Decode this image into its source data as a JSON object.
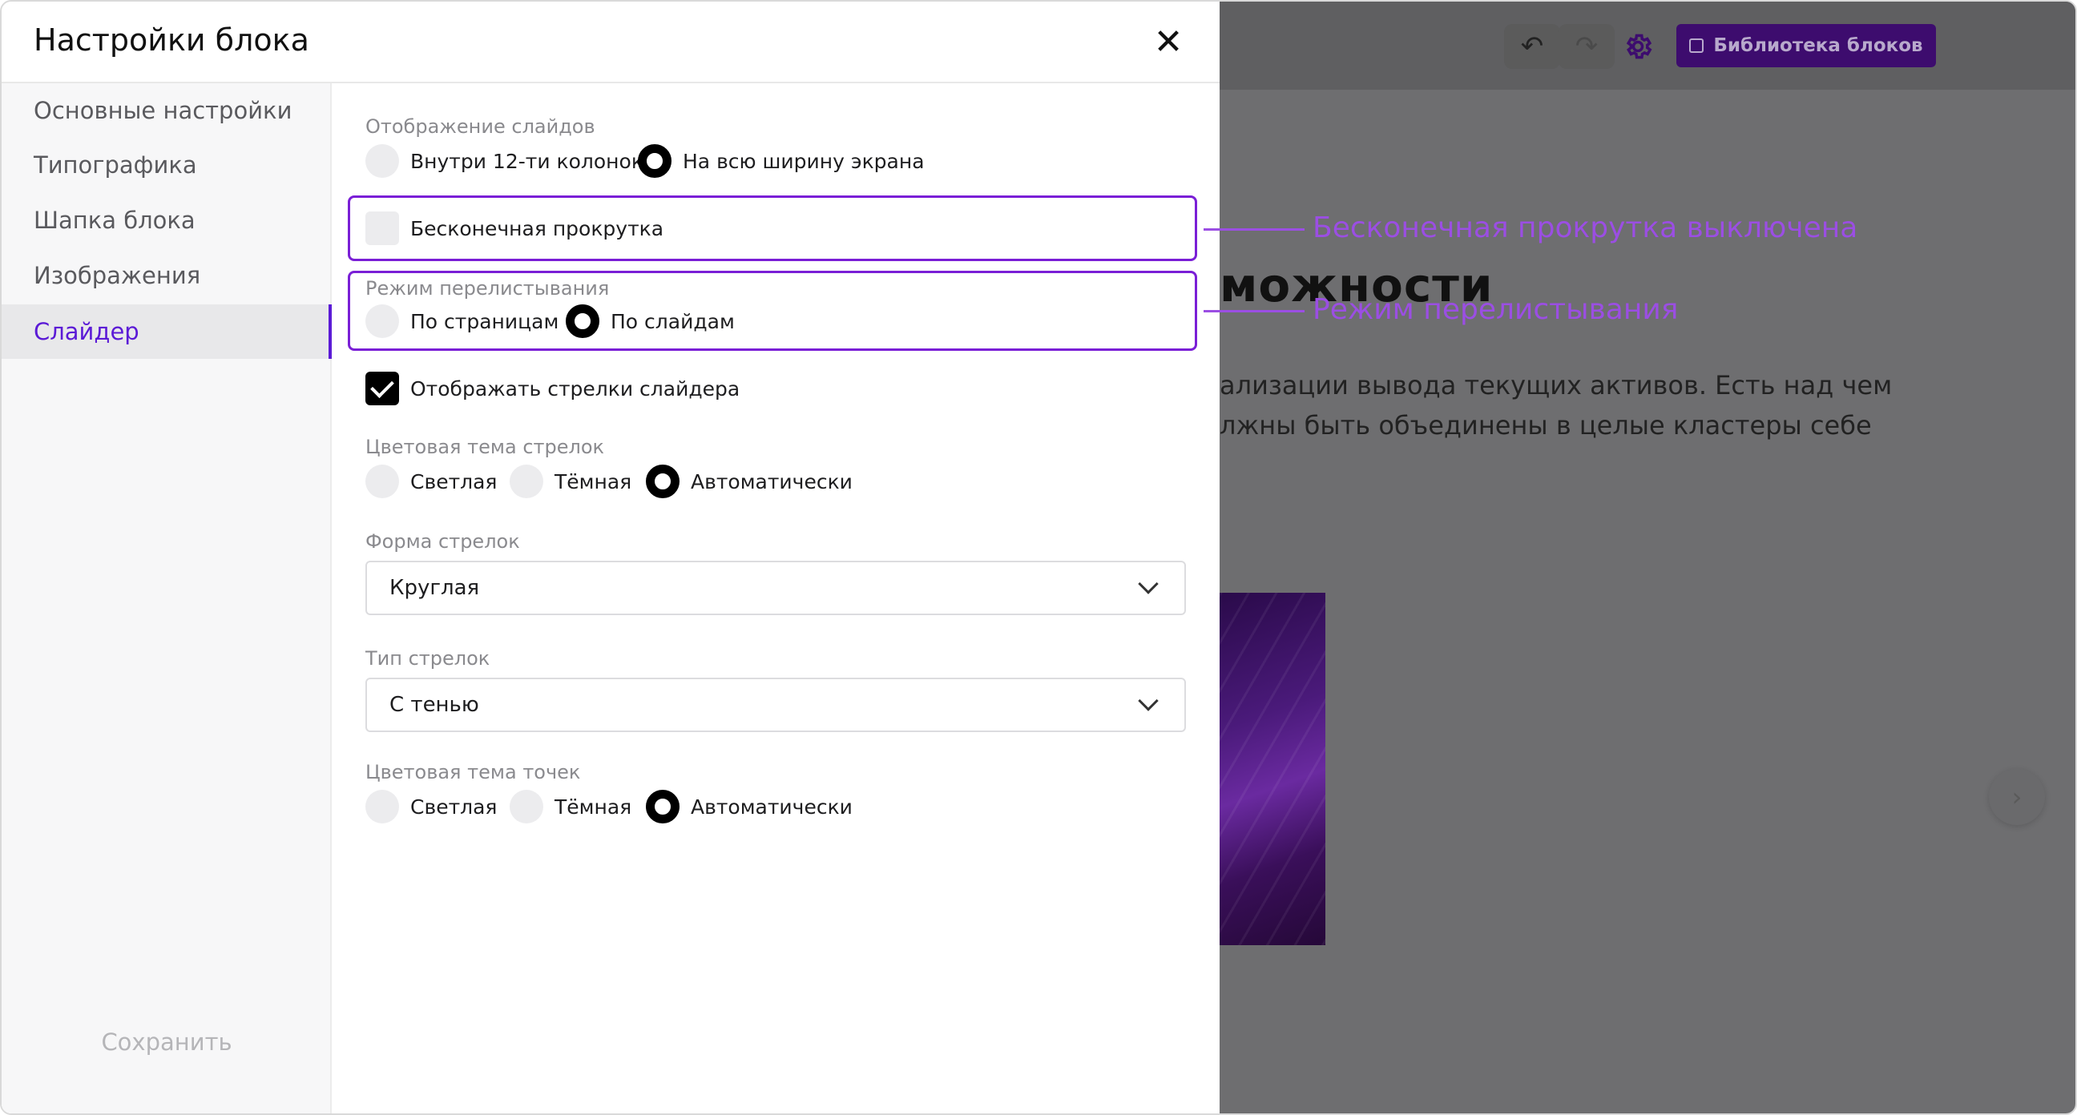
{
  "modal": {
    "title": "Настройки блока",
    "close_glyph": "✕"
  },
  "sidebar": {
    "items": [
      {
        "label": "Основные настройки",
        "active": false
      },
      {
        "label": "Типографика",
        "active": false
      },
      {
        "label": "Шапка блока",
        "active": false
      },
      {
        "label": "Изображения",
        "active": false
      },
      {
        "label": "Слайдер",
        "active": true
      }
    ],
    "save_label": "Сохранить"
  },
  "settings": {
    "slide_display": {
      "label": "Отображение слайдов",
      "options": [
        "Внутри 12-ти колонок",
        "На всю ширину экрана"
      ],
      "selected": "На всю ширину экрана"
    },
    "infinite_scroll": {
      "label": "Бесконечная прокрутка",
      "checked": false
    },
    "scroll_mode": {
      "label": "Режим перелистывания",
      "options": [
        "По страницам",
        "По слайдам"
      ],
      "selected": "По слайдам"
    },
    "show_arrows": {
      "label": "Отображать стрелки слайдера",
      "checked": true
    },
    "arrow_theme": {
      "label": "Цветовая тема стрелок",
      "options": [
        "Светлая",
        "Тёмная",
        "Автоматически"
      ],
      "selected": "Автоматически"
    },
    "arrow_shape": {
      "label": "Форма стрелок",
      "value": "Круглая"
    },
    "arrow_type": {
      "label": "Тип стрелок",
      "value": "С тенью"
    },
    "dot_theme": {
      "label": "Цветовая тема точек",
      "options": [
        "Светлая",
        "Тёмная",
        "Автоматически"
      ],
      "selected": "Автоматически"
    }
  },
  "annotations": {
    "infinite_scroll": "Бесконечная прокрутка выключена",
    "scroll_mode": "Режим перелистывания"
  },
  "background": {
    "library_button": "Библиотека блоков",
    "heading": "можности",
    "paragraph_line1": "ализации вывода текущих активов. Есть над чем",
    "paragraph_line2": "лжны быть объединены в целые кластеры себе"
  },
  "colors": {
    "accent": "#5b1ad6",
    "highlight": "#7a1fd6",
    "annotation": "#9b4ee3"
  }
}
